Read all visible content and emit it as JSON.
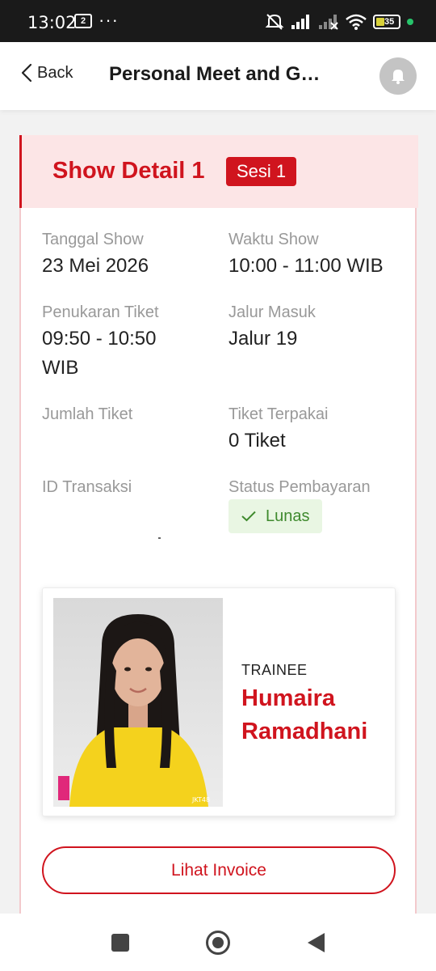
{
  "status_bar": {
    "time": "13:02",
    "notification_icon": "sim-2-icon",
    "more_icon": "ellipsis-icon",
    "right_icons": [
      "mute-icon",
      "signal-icon",
      "signal-off-icon",
      "wifi-icon"
    ],
    "battery": "35",
    "indicator_color": "#27c46b"
  },
  "header": {
    "back_label": "Back",
    "title": "Personal Meet and Gr…",
    "notification_icon": "bell-icon"
  },
  "show": {
    "title": "Show Detail 1",
    "session_badge": "Sesi 1",
    "fields": {
      "date_label": "Tanggal Show",
      "date_value": "23 Mei 2026",
      "time_label": "Waktu Show",
      "time_value": "10:00 - 11:00 WIB",
      "exchange_label": "Penukaran Tiket",
      "exchange_value": "09:50 - 10:50 WIB",
      "gate_label": "Jalur Masuk",
      "gate_value": "Jalur 19",
      "qty_label": "Jumlah Tiket",
      "used_label": "Tiket Terpakai",
      "used_value": "0 Tiket",
      "trx_label": "ID Transaksi",
      "payment_label": "Status Pembayaran",
      "payment_value": "Lunas"
    }
  },
  "member": {
    "type": "TRAINEE",
    "name": "Humaira Ramadhani",
    "photo_watermark": "JKT48"
  },
  "invoice_button": "Lihat Invoice",
  "colors": {
    "accent": "#d0141e",
    "header_bg": "#fce5e6",
    "success_bg": "#e9f6e3",
    "success_text": "#3f8a2e"
  }
}
